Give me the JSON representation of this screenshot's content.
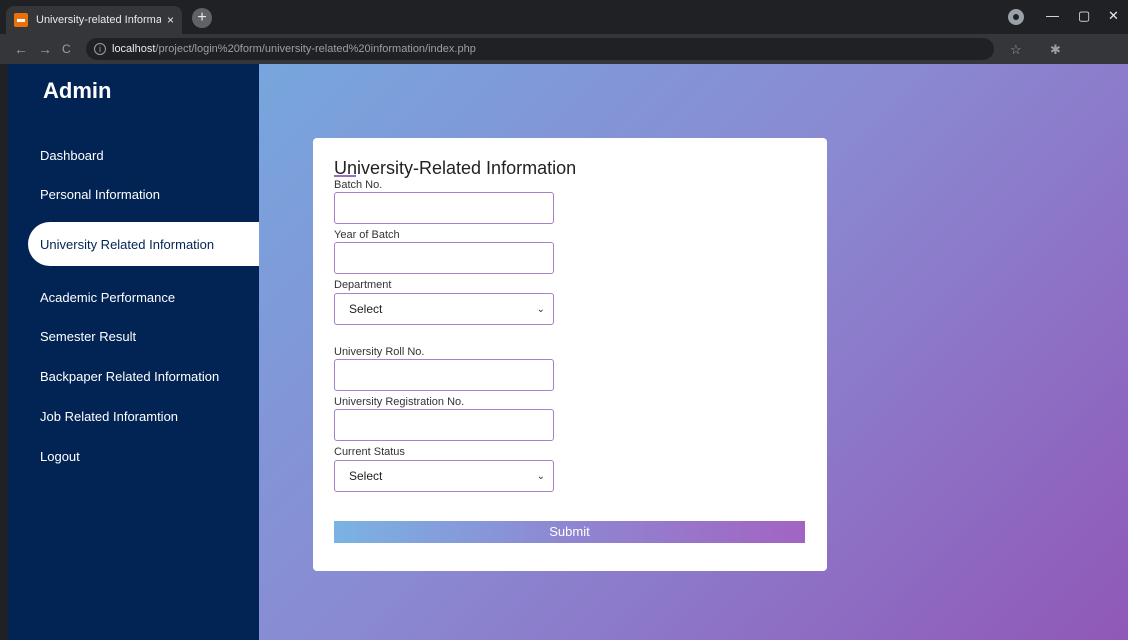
{
  "browser": {
    "tab_title": "University-related Information",
    "tab_close": "×",
    "new_tab": "+",
    "url_host": "localhost",
    "url_path": "/project/login%20form/university-related%20information/index.php",
    "win_minimize": "—",
    "win_maximize": "▢",
    "win_close": "✕",
    "back": "←",
    "forward": "→",
    "reload": "C",
    "info": "i"
  },
  "sidebar": {
    "title": "Admin",
    "items": [
      {
        "label": "Dashboard"
      },
      {
        "label": "Personal Information"
      },
      {
        "label": "University Related Information"
      },
      {
        "label": "Academic Performance"
      },
      {
        "label": "Semester Result"
      },
      {
        "label": "Backpaper Related Information"
      },
      {
        "label": "Job Related Inforamtion"
      },
      {
        "label": "Logout"
      }
    ]
  },
  "form": {
    "title": "University-Related Information",
    "fields": [
      {
        "label": "Batch No.",
        "value": ""
      },
      {
        "label": "Year of Batch",
        "value": ""
      },
      {
        "label": "Department",
        "value": "Select"
      },
      {
        "label": "University Roll No.",
        "value": ""
      },
      {
        "label": "University Registration No.",
        "value": ""
      },
      {
        "label": "Current Status",
        "value": "Select"
      }
    ],
    "submit_label": "Submit"
  },
  "colors": {
    "sidebar_bg": "#022454",
    "accent_purple": "#a77fcb",
    "gradient_start": "#77a6dd",
    "gradient_end": "#9058b8"
  },
  "icons": {
    "chevron": "⌄",
    "star": "☆",
    "puzzle": "✱"
  }
}
